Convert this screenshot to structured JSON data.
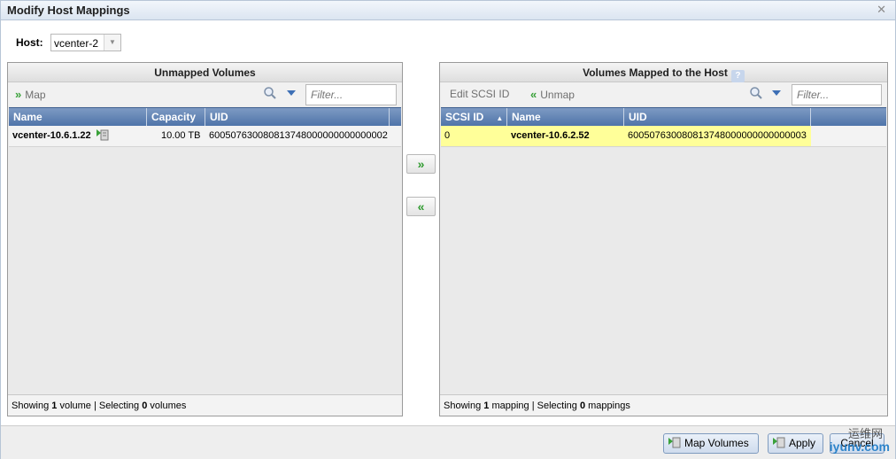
{
  "dialog": {
    "title": "Modify Host Mappings"
  },
  "host": {
    "label": "Host:",
    "value": "vcenter-2"
  },
  "left": {
    "title": "Unmapped Volumes",
    "toolbar": {
      "map_label": "Map",
      "filter_placeholder": "Filter..."
    },
    "columns": [
      "Name",
      "Capacity",
      "UID"
    ],
    "rows": [
      {
        "name": "vcenter-10.6.1.22",
        "capacity": "10.00 TB",
        "uid": "600507630080813748000000000000002"
      }
    ],
    "footer": {
      "showing": "Showing",
      "count": "1",
      "unit": "volume | Selecting",
      "selecting": "0",
      "unit2": "volumes"
    }
  },
  "right": {
    "title": "Volumes Mapped to the Host",
    "toolbar": {
      "edit_label": "Edit SCSI ID",
      "unmap_label": "Unmap",
      "filter_placeholder": "Filter..."
    },
    "columns": [
      "SCSI ID",
      "Name",
      "UID"
    ],
    "rows": [
      {
        "scsi_id": "0",
        "name": "vcenter-10.6.2.52",
        "uid": "600507630080813748000000000000003"
      }
    ],
    "footer": {
      "showing": "Showing",
      "count": "1",
      "unit": "mapping | Selecting",
      "selecting": "0",
      "unit2": "mappings"
    }
  },
  "buttons": {
    "map_volumes": "Map Volumes",
    "apply": "Apply",
    "cancel": "Cancel"
  },
  "watermark": {
    "cn": "运维网",
    "text": "iyunv.com"
  },
  "colors": {
    "header_blue": "#5e80b0",
    "selected_row": "#ffff99",
    "arrow_green": "#2e9a2e"
  }
}
